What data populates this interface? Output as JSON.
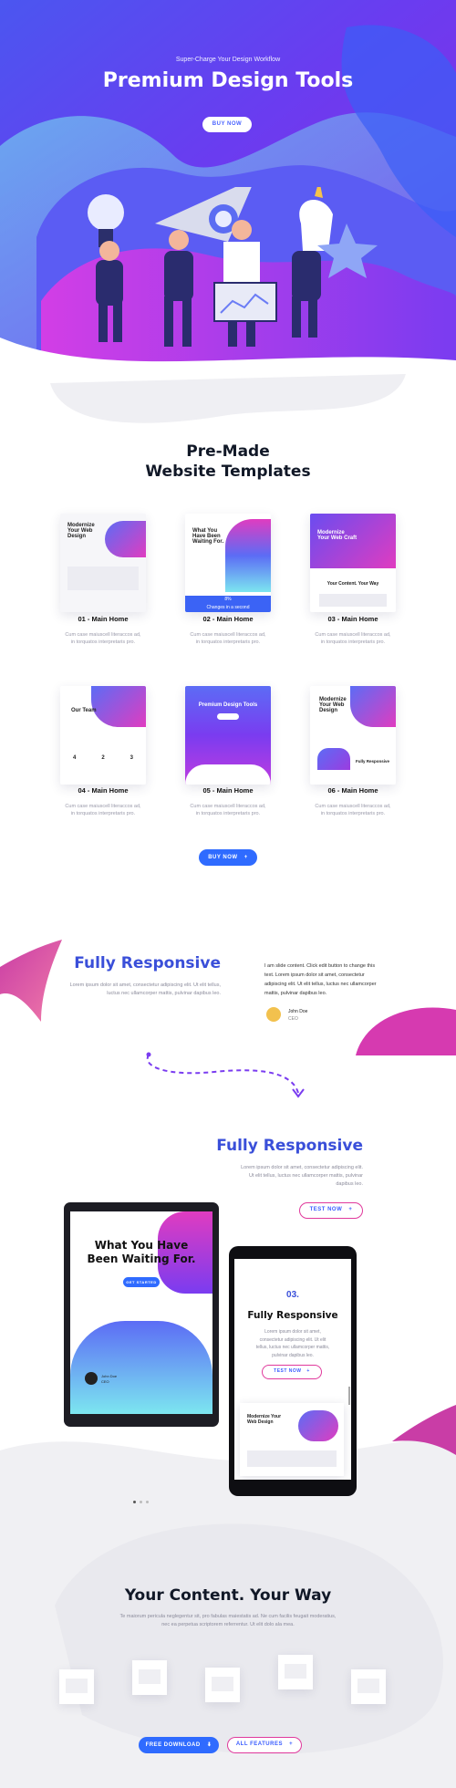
{
  "hero": {
    "kicker": "Super-Charge Your Design Workflow",
    "title": "Premium Design Tools",
    "button": "BUY NOW"
  },
  "templates": {
    "title_line1": "Pre-Made",
    "title_line2": "Website Templates",
    "items": [
      {
        "title": "01 - Main Home",
        "desc1": "Cum case maiuscell literaccos ad,",
        "desc2": "in torquatos interpretaris pro.",
        "thumb": "Modernize Your Web Design"
      },
      {
        "title": "02 - Main Home",
        "desc1": "Cum case maiuscell literaccos ad,",
        "desc2": "in torquatos interpretaris pro.",
        "thumb": "What You Have Been Waiting For.",
        "stat": "8%",
        "stat_label": "Changes in a second"
      },
      {
        "title": "03 - Main Home",
        "desc1": "Cum case maiuscell literaccos ad,",
        "desc2": "in torquatos interpretaris pro.",
        "thumb": "Modernize Your Web Craft",
        "thumb2": "Your Content. Your Way"
      },
      {
        "title": "04 - Main Home",
        "desc1": "Cum case maiuscell literaccos ad,",
        "desc2": "in torquatos interpretaris pro.",
        "thumb": "Our Team",
        "nums": [
          "4",
          "2",
          "3"
        ]
      },
      {
        "title": "05 - Main Home",
        "desc1": "Cum case maiuscell literaccos ad,",
        "desc2": "in torquatos interpretaris pro.",
        "thumb": "Premium Design Tools"
      },
      {
        "title": "06 - Main Home",
        "desc1": "Cum case maiuscell literaccos ad,",
        "desc2": "in torquatos interpretaris pro.",
        "thumb": "Modernize Your Web Design",
        "thumb2": "Fully Responsive"
      }
    ],
    "button": "BUY NOW"
  },
  "responsive1": {
    "title": "Fully Responsive",
    "body1": "Lorem ipsum dolor sit amet, consectetur adipiscing elit. Ut elit tellus,",
    "body2": "luctus nec ullamcorper mattis, pulvinar dapibus leo.",
    "quote1": "I am slide content. Click edit button to change this",
    "quote2": "text. Lorem ipsum dolor sit amet, consectetur",
    "quote3": "adipiscing elit. Ut elit tellus, luctus nec ullamcorper",
    "quote4": "mattis, pulvinar dapibus leo.",
    "author_name": "John Doe",
    "author_role": "CEO"
  },
  "responsive2": {
    "title": "Fully Responsive",
    "body1": "Lorem ipsum dolor sit amet, consectetur adipiscing elit.",
    "body2": "Ut elit tellus, luctus nec ullamcorper mattis, pulvinar",
    "body3": "dapibus leo.",
    "button": "TEST NOW",
    "tablet_title1": "What You Have",
    "tablet_title2": "Been Waiting For.",
    "tablet_btn": "GET STARTED",
    "tablet_author": "John Doe",
    "tablet_role": "CEO",
    "phone_num": "03.",
    "phone_title": "Fully Responsive",
    "phone_body1": "Lorem ipsum dolor sit amet,",
    "phone_body2": "consectetur adipiscing elit. Ut elit",
    "phone_body3": "tellus, luctus nec ullamcorper mattis,",
    "phone_body4": "pulvinar dapibus leo.",
    "phone_btn": "TEST NOW",
    "phone_thumb": "Modernize Your Web Design"
  },
  "content": {
    "title": "Your Content. Your Way",
    "body1": "Te maiorum pericula neglegentur sit, pro fabulas maiestatis ad. Ne cum facilis feugait moderatius,",
    "body2": "nec ea perpetua scriptorem referrentur. Ut elit dolo ala mea.",
    "btn_download": "FREE DOWNLOAD",
    "btn_features": "ALL FEATURES"
  },
  "colors": {
    "blue": "#2f6bff",
    "purple": "#8a2be2",
    "magenta": "#e0399c",
    "title_blue": "#3a4fd9"
  }
}
